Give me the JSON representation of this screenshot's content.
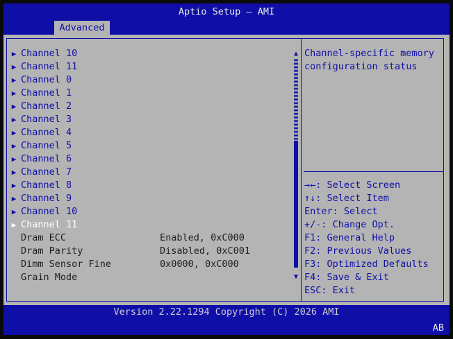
{
  "header": {
    "title": "Aptio Setup – AMI",
    "tab": "Advanced"
  },
  "menu": {
    "items": [
      {
        "label": "Channel 10",
        "arrow": "▶"
      },
      {
        "label": "Channel 11",
        "arrow": "▶"
      },
      {
        "label": "Channel 0",
        "arrow": "▶"
      },
      {
        "label": "Channel 1",
        "arrow": "▶"
      },
      {
        "label": "Channel 2",
        "arrow": "▶"
      },
      {
        "label": "Channel 3",
        "arrow": "▶"
      },
      {
        "label": "Channel 4",
        "arrow": "▶"
      },
      {
        "label": "Channel 5",
        "arrow": "▶"
      },
      {
        "label": "Channel 6",
        "arrow": "▶"
      },
      {
        "label": "Channel 7",
        "arrow": "▶"
      },
      {
        "label": "Channel 8",
        "arrow": "▶"
      },
      {
        "label": "Channel 9",
        "arrow": "▶"
      },
      {
        "label": "Channel 10",
        "arrow": "▶"
      },
      {
        "label": "Channel 11",
        "arrow": "▶"
      }
    ],
    "settings": [
      {
        "label": "Dram ECC",
        "value": "Enabled, 0xC000"
      },
      {
        "label": "Dram Parity",
        "value": "Disabled, 0xC001"
      },
      {
        "label": "Dimm Sensor Fine",
        "value": "0x0000, 0xC000"
      },
      {
        "label": "Grain Mode",
        "value": ""
      }
    ]
  },
  "scrollbar": {
    "up": "▲",
    "down": "▼"
  },
  "help": {
    "line1": "Channel-specific memory",
    "line2": "configuration status"
  },
  "keys": [
    "→←: Select Screen",
    "↑↓: Select Item",
    "Enter: Select",
    "+/-: Change Opt.",
    "F1: General Help",
    "F2: Previous Values",
    "F3: Optimized Defaults",
    "F4: Save & Exit",
    "ESC: Exit"
  ],
  "footer": {
    "version": "Version 2.22.1294 Copyright (C) 2026 AMI",
    "badge": "AB"
  },
  "colors": {
    "frame": "#0f0fa8",
    "panel": "#b4b4b4",
    "selected": "#ffffff",
    "text": "#1e1e1e"
  }
}
